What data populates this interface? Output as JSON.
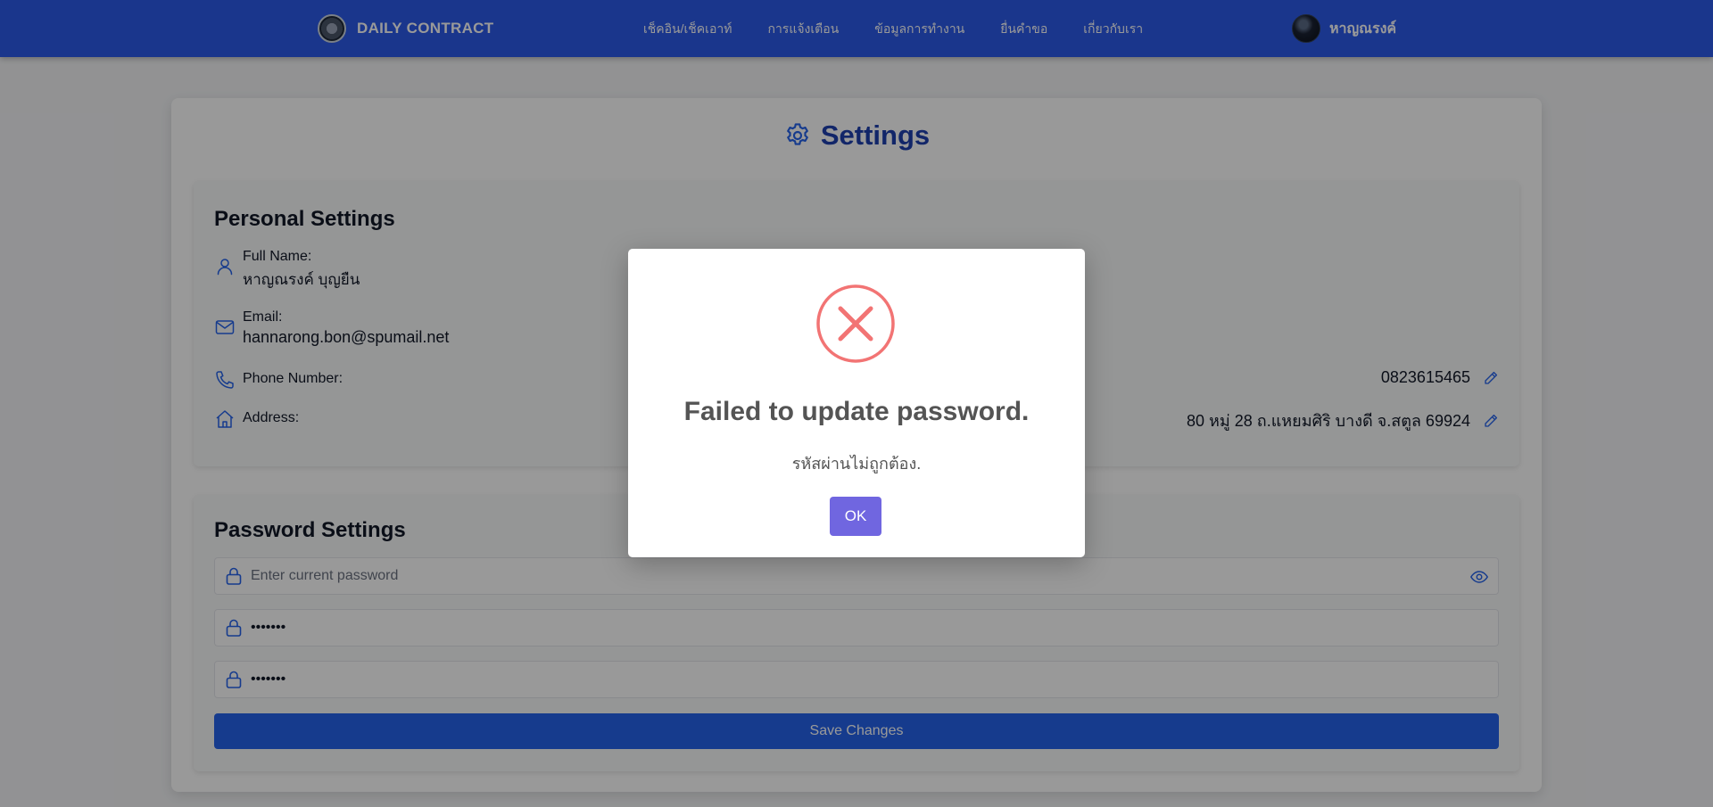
{
  "navbar": {
    "brand": "DAILY CONTRACT",
    "links": [
      "เช็คอิน/เช็คเอาท์",
      "การแจ้งเตือน",
      "ข้อมูลการทำงาน",
      "ยื่นคำขอ",
      "เกี่ยวกับเรา"
    ],
    "user_name": "หาญณรงค์"
  },
  "settings": {
    "title": "Settings",
    "personal": {
      "heading": "Personal Settings",
      "full_name_label": "Full Name:",
      "full_name": "หาญณรงค์ บุญยืน",
      "email_label": "Email:",
      "email": "hannarong.bon@spumail.net",
      "phone_label": "Phone Number:",
      "phone": "0823615465",
      "address_label": "Address:",
      "address": "80 หมู่ 28 ถ.แหยมศิริ บางดี จ.สตูล 69924"
    },
    "password": {
      "heading": "Password Settings",
      "current_placeholder": "Enter current password",
      "current_value": "",
      "new_value": "•••••••",
      "confirm_value": "•••••••",
      "save_label": "Save Changes"
    }
  },
  "modal": {
    "title": "Failed to update password.",
    "message": "รหัสผ่านไม่ถูกต้อง.",
    "ok_label": "OK",
    "icon": "error-x-icon"
  },
  "colors": {
    "navbar": "#2c5ae9",
    "accent": "#2563eb",
    "title": "#1e40af",
    "error": "#f27474",
    "confirm_button": "#7066e0"
  }
}
